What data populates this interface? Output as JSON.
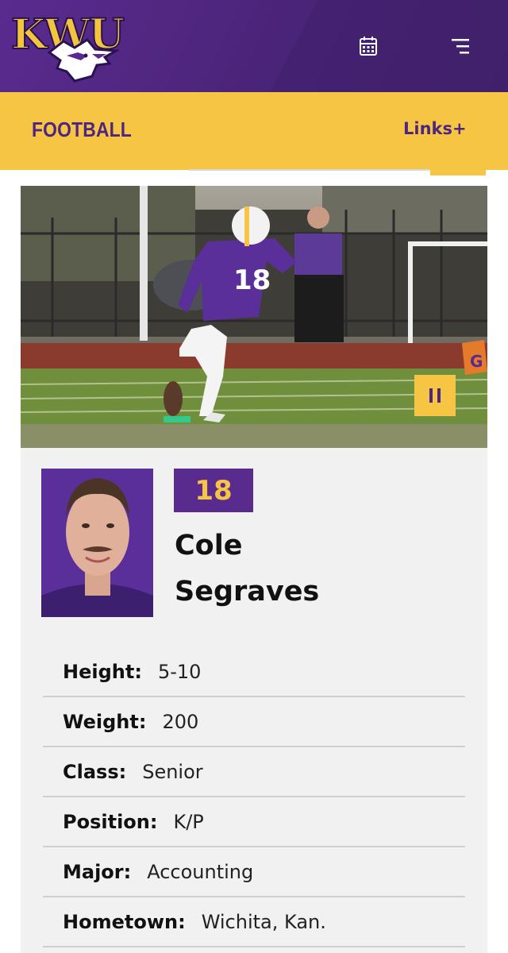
{
  "header": {
    "logo_text": "KWU",
    "calendar_icon": "calendar-icon",
    "menu_icon": "menu-icon"
  },
  "sportbar": {
    "title": "FOOTBALL",
    "links_label": "Links+"
  },
  "player": {
    "number": "18",
    "first_name": "Cole",
    "last_name": "Segraves",
    "jersey_number_in_photo": "18",
    "stats": [
      {
        "label": "Height:",
        "value": "5-10"
      },
      {
        "label": "Weight:",
        "value": "200"
      },
      {
        "label": "Class:",
        "value": "Senior"
      },
      {
        "label": "Position:",
        "value": "K/P"
      },
      {
        "label": "Major:",
        "value": "Accounting"
      },
      {
        "label": "Hometown:",
        "value": "Wichita, Kan."
      }
    ]
  },
  "colors": {
    "purple": "#5a2b8f",
    "gold": "#f5c543",
    "card_bg": "#f1f1f1"
  }
}
